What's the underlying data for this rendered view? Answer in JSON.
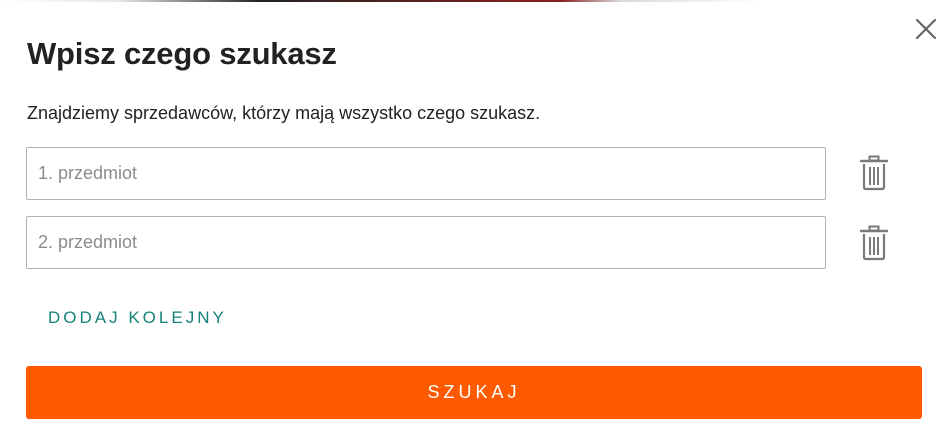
{
  "dialog": {
    "title": "Wpisz czego szukasz",
    "subtitle": "Znajdziemy sprzedawców, którzy mają wszystko czego szukasz.",
    "close_icon": "close-icon"
  },
  "items": [
    {
      "placeholder": "1. przedmiot",
      "value": "",
      "delete_icon": "trash-icon"
    },
    {
      "placeholder": "2. przedmiot",
      "value": "",
      "delete_icon": "trash-icon"
    }
  ],
  "actions": {
    "add_label": "DODAJ KOLEJNY",
    "submit_label": "SZUKAJ"
  },
  "colors": {
    "accent": "#ff5a00",
    "link": "#17827a",
    "text": "#222222",
    "border": "#b3b3b3",
    "placeholder": "#8c8c8c"
  }
}
